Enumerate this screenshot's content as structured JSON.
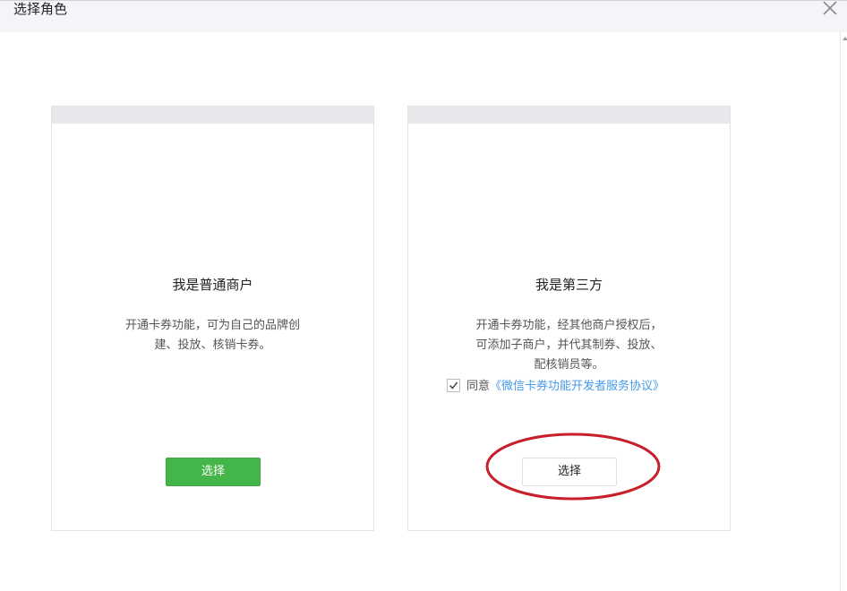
{
  "dialog": {
    "title": "选择角色"
  },
  "icons": {
    "close": "close-icon",
    "check": "check-icon"
  },
  "colors": {
    "primary_button": "#44b549",
    "link": "#459ae9",
    "annotation": "#c8202a"
  },
  "cards": [
    {
      "title": "我是普通商户",
      "desc_line1": "开通卡券功能，可为自己的品牌创",
      "desc_line2": "建、投放、核销卡券。",
      "button_label": "选择"
    },
    {
      "title": "我是第三方",
      "desc_line1": "开通卡券功能，经其他商户授权后，",
      "desc_line2": "可添加子商户，并代其制券、投放、",
      "desc_line3": "配核销员等。",
      "agree_prefix": "同意",
      "agree_link": "《微信卡券功能开发者服务协议》",
      "agree_checked": true,
      "button_label": "选择"
    }
  ]
}
